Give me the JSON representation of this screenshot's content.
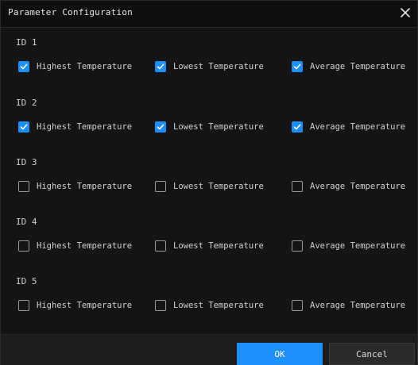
{
  "dialog": {
    "title": "Parameter Configuration",
    "close_icon": "close-icon"
  },
  "groups": [
    {
      "label": "ID 1",
      "options": [
        {
          "label": "Highest Temperature",
          "checked": true
        },
        {
          "label": "Lowest Temperature",
          "checked": true
        },
        {
          "label": "Average Temperature",
          "checked": true
        }
      ]
    },
    {
      "label": "ID 2",
      "options": [
        {
          "label": "Highest Temperature",
          "checked": true
        },
        {
          "label": "Lowest Temperature",
          "checked": true
        },
        {
          "label": "Average Temperature",
          "checked": true
        }
      ]
    },
    {
      "label": "ID 3",
      "options": [
        {
          "label": "Highest Temperature",
          "checked": false
        },
        {
          "label": "Lowest Temperature",
          "checked": false
        },
        {
          "label": "Average Temperature",
          "checked": false
        }
      ]
    },
    {
      "label": "ID 4",
      "options": [
        {
          "label": "Highest Temperature",
          "checked": false
        },
        {
          "label": "Lowest Temperature",
          "checked": false
        },
        {
          "label": "Average Temperature",
          "checked": false
        }
      ]
    },
    {
      "label": "ID 5",
      "options": [
        {
          "label": "Highest Temperature",
          "checked": false
        },
        {
          "label": "Lowest Temperature",
          "checked": false
        },
        {
          "label": "Average Temperature",
          "checked": false
        }
      ]
    }
  ],
  "footer": {
    "ok_label": "OK",
    "cancel_label": "Cancel"
  },
  "colors": {
    "accent": "#1e8fff",
    "background": "#141414",
    "text": "#d2d2d2"
  }
}
